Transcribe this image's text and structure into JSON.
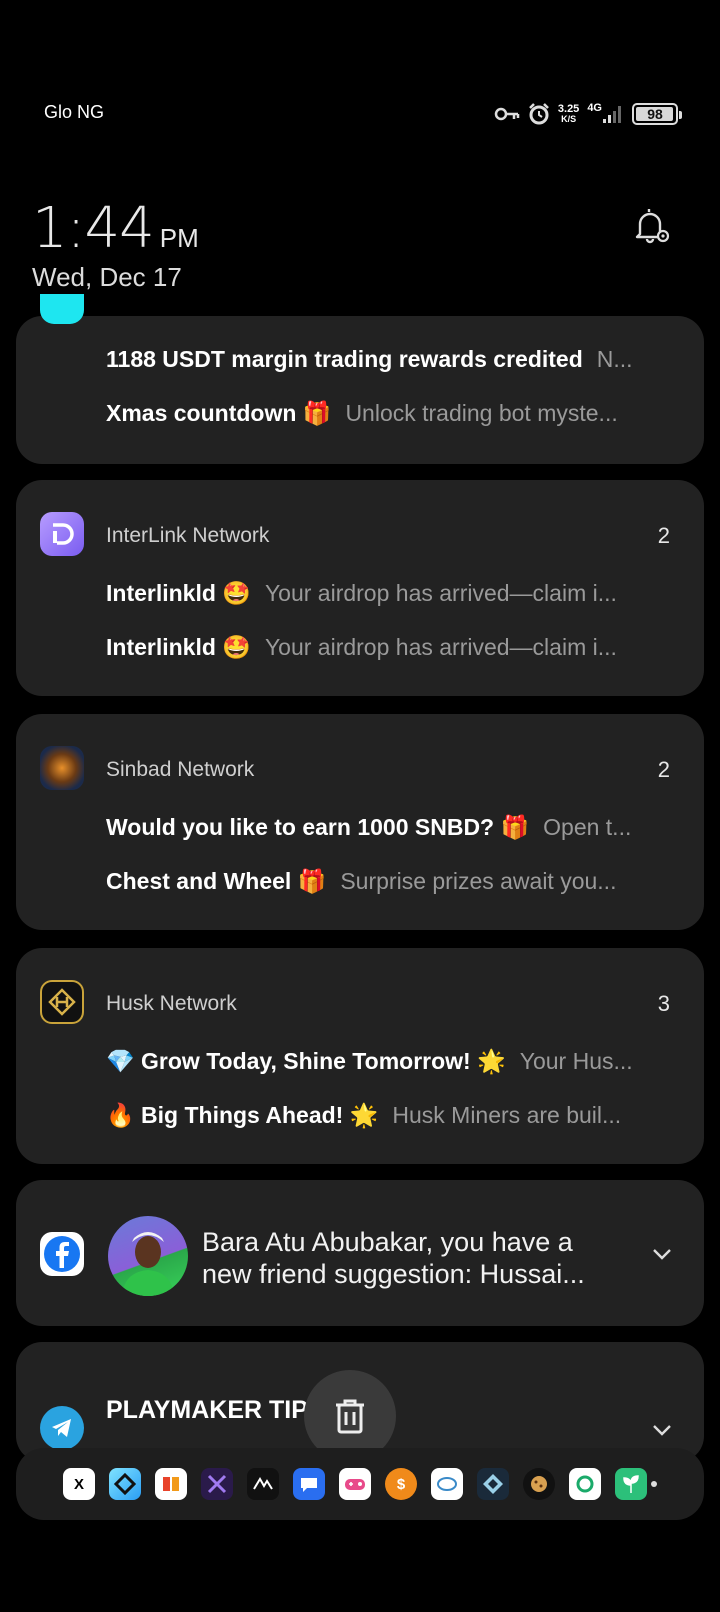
{
  "status": {
    "carrier": "Glo NG",
    "speed_value": "3.25",
    "speed_unit": "K/S",
    "network": "4G",
    "battery": "98",
    "battery_level": 0.98
  },
  "lockscreen": {
    "time": "1:44",
    "ampm": "PM",
    "date": "Wed, Dec 17"
  },
  "notifications": [
    {
      "app": "",
      "lines": [
        {
          "title": "1188 USDT margin trading rewards credited",
          "text": "N..."
        },
        {
          "title": "Xmas countdown 🎁",
          "text": "Unlock trading bot myste..."
        }
      ]
    },
    {
      "app": "InterLink Network",
      "count": "2",
      "lines": [
        {
          "title": "Interlinkld 🤩",
          "text": "Your airdrop has arrived—claim i..."
        },
        {
          "title": "Interlinkld 🤩",
          "text": "Your airdrop has arrived—claim i..."
        }
      ]
    },
    {
      "app": "Sinbad Network",
      "count": "2",
      "lines": [
        {
          "title": "Would you like to earn 1000 SNBD? 🎁",
          "text": "Open t..."
        },
        {
          "title": "Chest and Wheel 🎁",
          "text": "Surprise prizes await you..."
        }
      ]
    },
    {
      "app": "Husk Network",
      "count": "3",
      "lines": [
        {
          "title": "💎 Grow Today, Shine Tomorrow! 🌟",
          "text": "Your Hus..."
        },
        {
          "title": "🔥 Big Things Ahead! 🌟",
          "text": "Husk Miners are buil..."
        }
      ]
    },
    {
      "app": "Facebook",
      "text": "Bara Atu Abubakar, you have a new friend suggestion: Hussai..."
    },
    {
      "app": "Telegram",
      "title": "PLAYMAKER TIP"
    }
  ],
  "dock": {
    "icons": [
      "x-icon",
      "app-icon",
      "app-icon",
      "app-icon",
      "app-icon",
      "chat-icon",
      "game-icon",
      "dollar-icon",
      "app-icon",
      "app-icon",
      "cookie-icon",
      "app-icon",
      "plant-icon"
    ],
    "x_glyph": "X",
    "dollar_glyph": "$"
  },
  "colors": {
    "card_bg": "#222222",
    "accent_cyan": "#1ee6f0",
    "facebook_blue": "#1877f2",
    "telegram_blue": "#2aa3e0"
  }
}
